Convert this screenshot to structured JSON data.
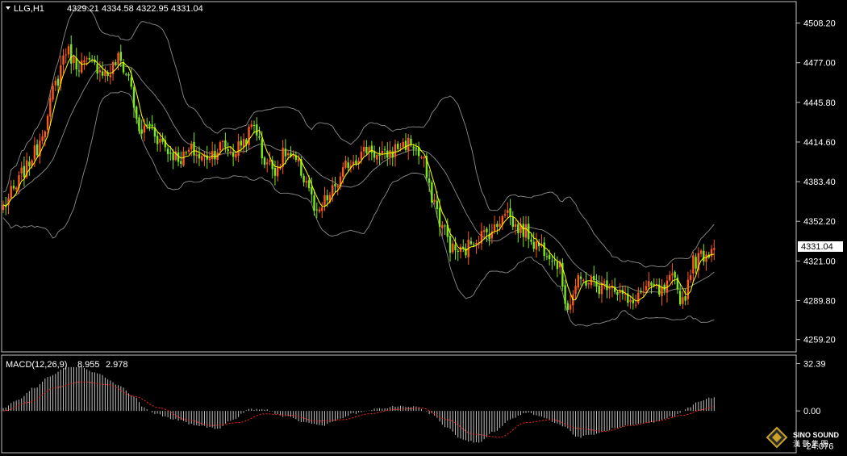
{
  "symbol_label": "LLG,H1",
  "ohlc": {
    "open": "4329.21",
    "high": "4334.58",
    "low": "4322.95",
    "close": "4331.04"
  },
  "price_marker": "4331.04",
  "macd": {
    "label": "MACD(12,26,9)",
    "macd_value": "8.955",
    "signal_value": "2.978"
  },
  "watermark": {
    "brand": "SINO SOUND",
    "chinese": "漢 聲 集 團"
  },
  "colors": {
    "background": "#000000",
    "frame": "#c0c0c0",
    "bull": "#ff5a1a",
    "bear": "#7ce817",
    "ma_fast": "#ffff00",
    "bands": "#8c8c8c",
    "histogram": "#c0c0c0",
    "signal": "#ff2020"
  },
  "chart_data": [
    {
      "type": "candlestick",
      "title": "",
      "series_name": "",
      "y_ticks": [
        "4508.20",
        "4477.00",
        "4445.80",
        "4414.60",
        "4383.40",
        "4352.20",
        "4321.00",
        "4289.80",
        "4259.20"
      ],
      "ylim": [
        4252,
        4520
      ],
      "overlays": [
        "moving average (yellow)",
        "bollinger bands (grey)"
      ],
      "anchors": [
        [
          0,
          4364
        ],
        [
          4,
          4376
        ],
        [
          8,
          4392
        ],
        [
          12,
          4406
        ],
        [
          16,
          4428
        ],
        [
          20,
          4460
        ],
        [
          24,
          4487
        ],
        [
          28,
          4476
        ],
        [
          32,
          4476
        ],
        [
          36,
          4474
        ],
        [
          40,
          4468
        ],
        [
          44,
          4480
        ],
        [
          48,
          4466
        ],
        [
          52,
          4422
        ],
        [
          56,
          4428
        ],
        [
          60,
          4416
        ],
        [
          64,
          4406
        ],
        [
          68,
          4402
        ],
        [
          72,
          4408
        ],
        [
          76,
          4402
        ],
        [
          80,
          4406
        ],
        [
          84,
          4412
        ],
        [
          88,
          4406
        ],
        [
          92,
          4416
        ],
        [
          96,
          4428
        ],
        [
          100,
          4400
        ],
        [
          104,
          4394
        ],
        [
          108,
          4406
        ],
        [
          112,
          4398
        ],
        [
          116,
          4384
        ],
        [
          120,
          4356
        ],
        [
          124,
          4370
        ],
        [
          128,
          4382
        ],
        [
          132,
          4398
        ],
        [
          136,
          4404
        ],
        [
          140,
          4410
        ],
        [
          144,
          4402
        ],
        [
          148,
          4406
        ],
        [
          152,
          4412
        ],
        [
          156,
          4414
        ],
        [
          160,
          4402
        ],
        [
          164,
          4372
        ],
        [
          168,
          4348
        ],
        [
          172,
          4330
        ],
        [
          176,
          4328
        ],
        [
          180,
          4338
        ],
        [
          184,
          4342
        ],
        [
          188,
          4346
        ],
        [
          192,
          4362
        ],
        [
          196,
          4348
        ],
        [
          200,
          4344
        ],
        [
          204,
          4334
        ],
        [
          208,
          4330
        ],
        [
          212,
          4320
        ],
        [
          216,
          4286
        ],
        [
          220,
          4304
        ],
        [
          224,
          4306
        ],
        [
          228,
          4300
        ],
        [
          232,
          4304
        ],
        [
          236,
          4296
        ],
        [
          240,
          4286
        ],
        [
          244,
          4296
        ],
        [
          248,
          4300
        ],
        [
          252,
          4296
        ],
        [
          256,
          4306
        ],
        [
          260,
          4290
        ],
        [
          264,
          4320
        ],
        [
          268,
          4326
        ],
        [
          272,
          4331
        ]
      ]
    },
    {
      "type": "bar",
      "title": "MACD(12,26,9)",
      "y_ticks": [
        "32.39",
        "0.00",
        "-24.076"
      ],
      "ylim": [
        -27,
        36
      ],
      "histogram_anchors": [
        [
          0,
          2
        ],
        [
          6,
          8
        ],
        [
          12,
          16
        ],
        [
          18,
          24
        ],
        [
          24,
          30
        ],
        [
          30,
          30
        ],
        [
          36,
          26
        ],
        [
          44,
          18
        ],
        [
          50,
          10
        ],
        [
          54,
          2
        ],
        [
          58,
          -2
        ],
        [
          66,
          -6
        ],
        [
          74,
          -10
        ],
        [
          82,
          -12
        ],
        [
          88,
          -6
        ],
        [
          94,
          1
        ],
        [
          100,
          1
        ],
        [
          108,
          -4
        ],
        [
          116,
          -8
        ],
        [
          122,
          -10
        ],
        [
          128,
          -6
        ],
        [
          134,
          -2
        ],
        [
          142,
          1
        ],
        [
          150,
          3
        ],
        [
          158,
          3
        ],
        [
          164,
          -2
        ],
        [
          170,
          -12
        ],
        [
          176,
          -20
        ],
        [
          182,
          -22
        ],
        [
          188,
          -14
        ],
        [
          194,
          -6
        ],
        [
          200,
          -1
        ],
        [
          206,
          -4
        ],
        [
          214,
          -10
        ],
        [
          220,
          -18
        ],
        [
          226,
          -16
        ],
        [
          234,
          -12
        ],
        [
          240,
          -10
        ],
        [
          248,
          -8
        ],
        [
          256,
          -4
        ],
        [
          262,
          2
        ],
        [
          266,
          6
        ],
        [
          270,
          9
        ]
      ],
      "signal_anchors": [
        [
          0,
          0
        ],
        [
          10,
          6
        ],
        [
          20,
          16
        ],
        [
          30,
          20
        ],
        [
          40,
          18
        ],
        [
          50,
          10
        ],
        [
          60,
          2
        ],
        [
          70,
          -6
        ],
        [
          80,
          -10
        ],
        [
          90,
          -8
        ],
        [
          100,
          -2
        ],
        [
          110,
          -3
        ],
        [
          120,
          -7
        ],
        [
          130,
          -6
        ],
        [
          140,
          -2
        ],
        [
          150,
          1
        ],
        [
          160,
          2
        ],
        [
          170,
          -6
        ],
        [
          180,
          -16
        ],
        [
          190,
          -18
        ],
        [
          200,
          -8
        ],
        [
          210,
          -6
        ],
        [
          220,
          -12
        ],
        [
          230,
          -14
        ],
        [
          240,
          -10
        ],
        [
          250,
          -7
        ],
        [
          260,
          -3
        ],
        [
          268,
          1
        ],
        [
          272,
          3
        ]
      ]
    }
  ]
}
